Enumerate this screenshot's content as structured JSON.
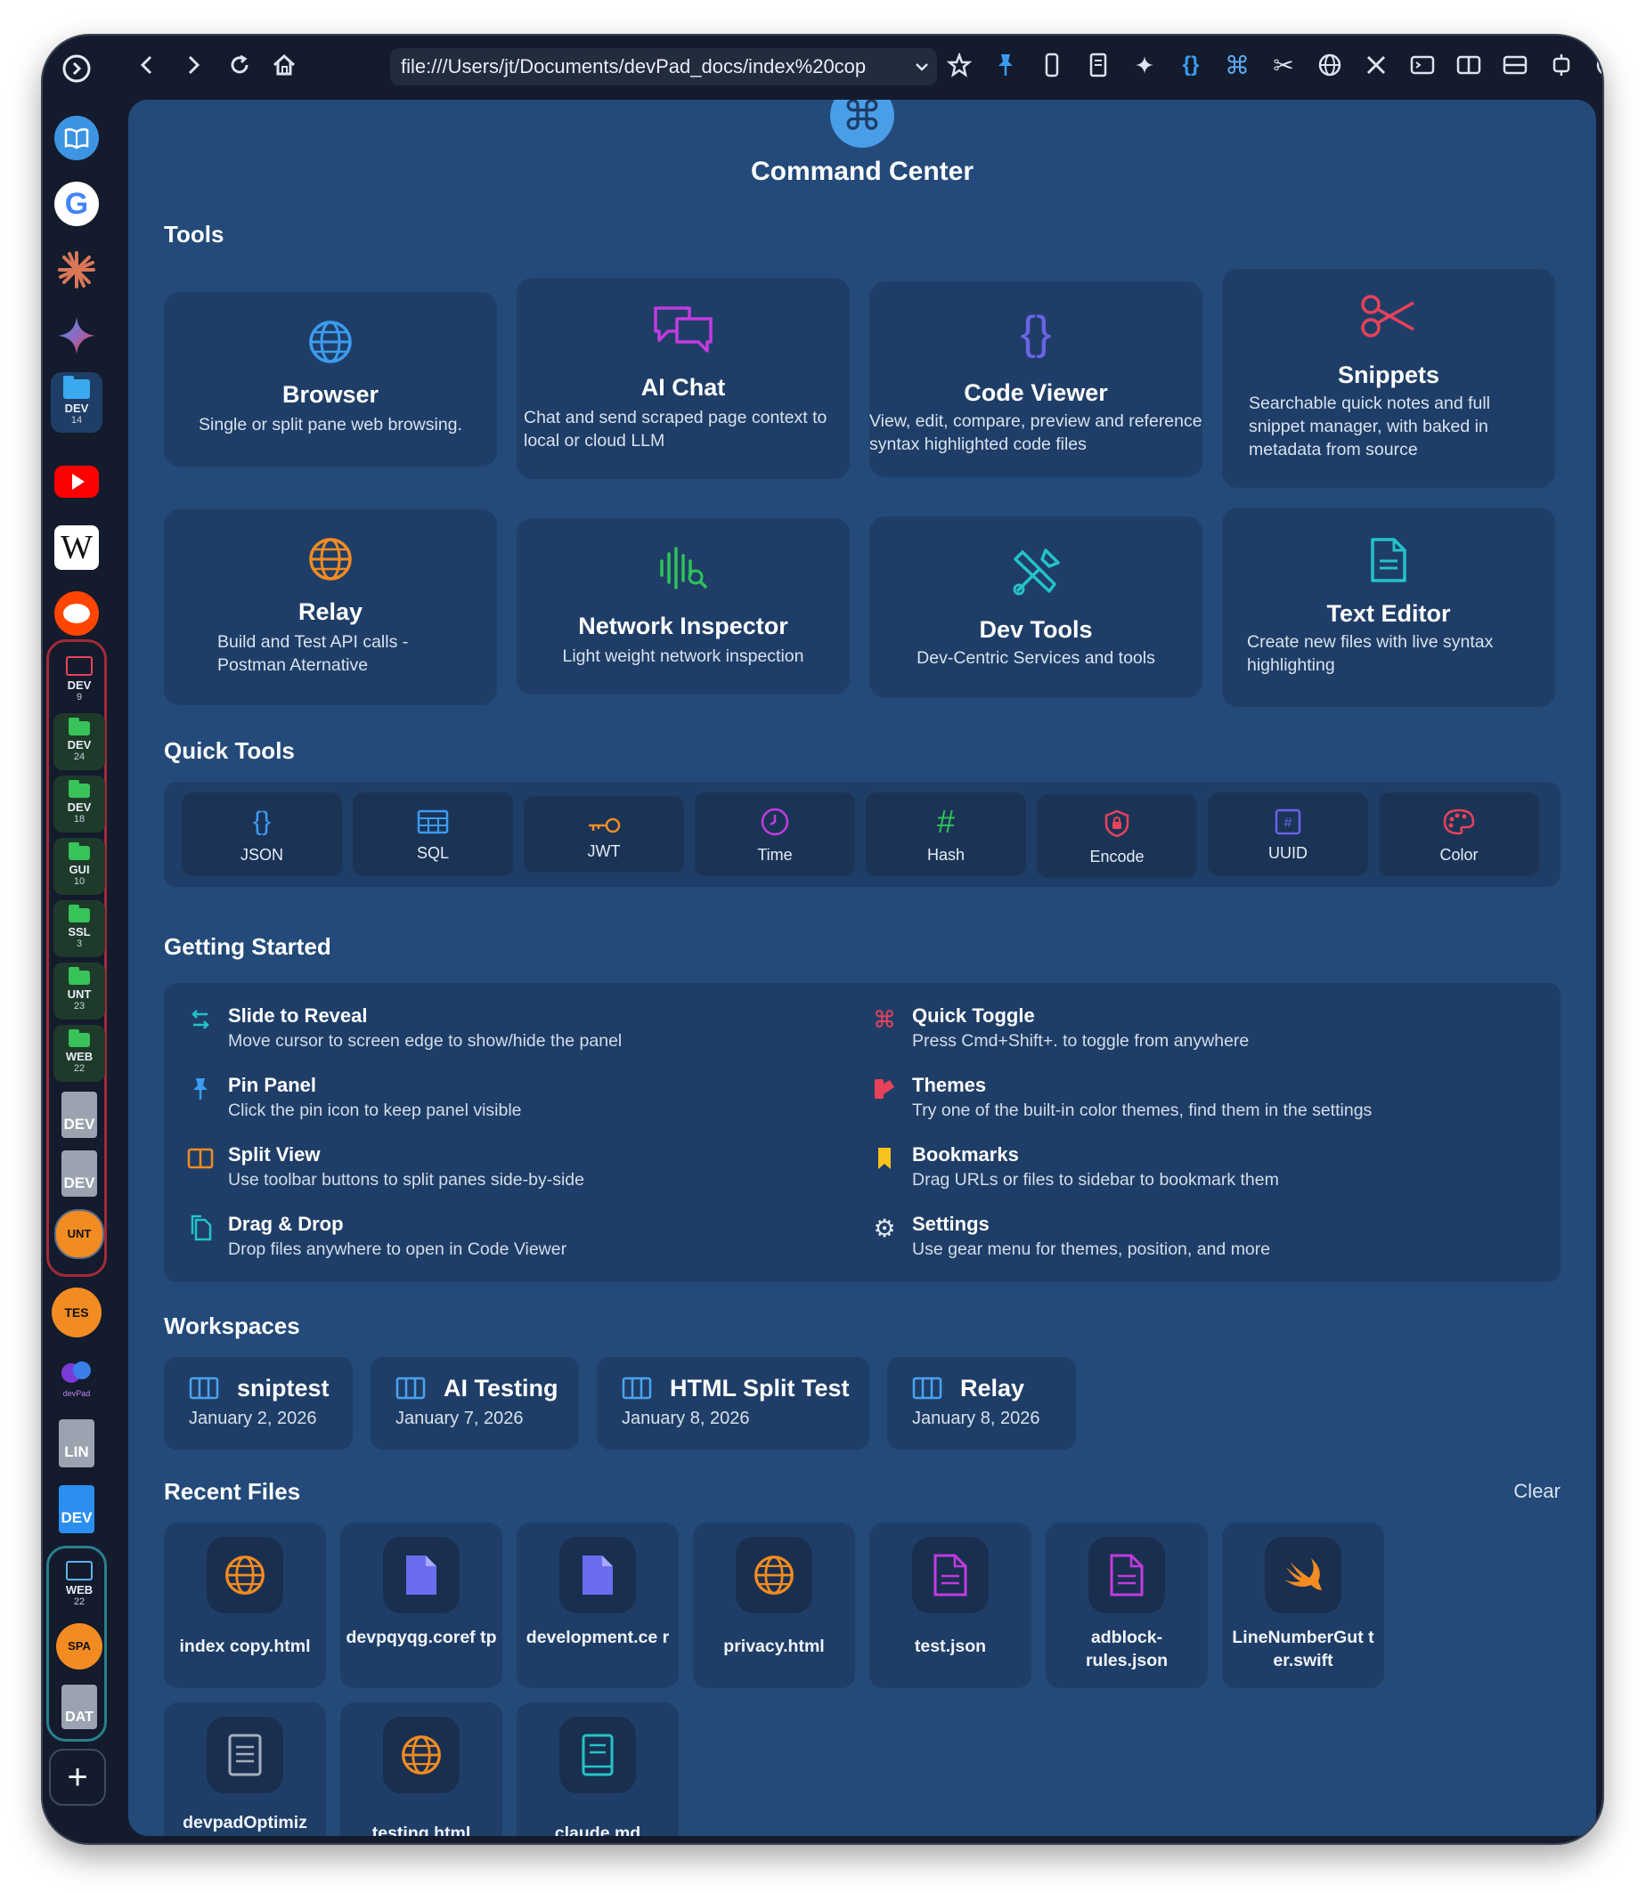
{
  "toolbar": {
    "url": "file:///Users/jt/Documents/devPad_docs/index%20cop",
    "icons": [
      "back-icon",
      "forward-icon",
      "reload-icon",
      "home-icon",
      "star-icon",
      "pin-icon",
      "mobile-icon",
      "reader-icon",
      "sparkle-icon",
      "braces-icon",
      "command-icon",
      "scissors-icon",
      "globe-icon",
      "tools-icon",
      "terminal-icon",
      "split-vertical-icon",
      "split-horizontal-icon",
      "extension-icon",
      "download-icon",
      "gear-icon"
    ]
  },
  "sidebar": {
    "items": [
      {
        "label": "DEV",
        "count": "14"
      },
      {
        "label": "DEV",
        "count": "9"
      },
      {
        "label": "DEV",
        "count": "24"
      },
      {
        "label": "DEV",
        "count": "18"
      },
      {
        "label": "GUI",
        "count": "10"
      },
      {
        "label": "SSL",
        "count": "3"
      },
      {
        "label": "UNT",
        "count": "23"
      },
      {
        "label": "WEB",
        "count": "22"
      },
      {
        "label": "DEV"
      },
      {
        "label": "DEV"
      },
      {
        "label": "UNT"
      },
      {
        "label": "TES"
      },
      {
        "label": "devPad"
      },
      {
        "label": "LIN"
      },
      {
        "label": "DEV"
      },
      {
        "label": "WEB",
        "count": "22"
      },
      {
        "label": "SPA"
      },
      {
        "label": "DAT"
      }
    ],
    "add_label": "+"
  },
  "header": {
    "title": "Command Center"
  },
  "sections": {
    "tools": "Tools",
    "quick_tools": "Quick Tools",
    "getting_started": "Getting Started",
    "workspaces": "Workspaces",
    "recent_files": "Recent Files",
    "clear": "Clear"
  },
  "tools": [
    {
      "title": "Browser",
      "desc": "Single or split pane web browsing."
    },
    {
      "title": "AI Chat",
      "desc": "Chat and send scraped page context to local or cloud LLM"
    },
    {
      "title": "Code Viewer",
      "desc": "View, edit, compare, preview and reference syntax highlighted code files"
    },
    {
      "title": "Snippets",
      "desc": "Searchable quick notes and full snippet manager, with baked in metadata from source"
    },
    {
      "title": "Relay",
      "desc": "Build and Test API calls - Postman Aternative"
    },
    {
      "title": "Network Inspector",
      "desc": "Light weight network inspection"
    },
    {
      "title": "Dev Tools",
      "desc": "Dev-Centric Services and tools"
    },
    {
      "title": "Text Editor",
      "desc": "Create new files with live syntax highlighting"
    }
  ],
  "quick_tools": [
    "JSON",
    "SQL",
    "JWT",
    "Time",
    "Hash",
    "Encode",
    "UUID",
    "Color"
  ],
  "getting_started": [
    {
      "title": "Slide to Reveal",
      "desc": "Move cursor to screen edge to show/hide the panel"
    },
    {
      "title": "Pin Panel",
      "desc": "Click the pin icon to keep panel visible"
    },
    {
      "title": "Split View",
      "desc": "Use toolbar buttons to split panes side-by-side"
    },
    {
      "title": "Drag & Drop",
      "desc": "Drop files anywhere to open in Code Viewer"
    },
    {
      "title": "Quick Toggle",
      "desc": "Press Cmd+Shift+. to toggle from anywhere"
    },
    {
      "title": "Themes",
      "desc": "Try one of the built-in color themes, find them in the settings"
    },
    {
      "title": "Bookmarks",
      "desc": "Drag URLs or files to sidebar to bookmark them"
    },
    {
      "title": "Settings",
      "desc": "Use gear menu for themes, position, and more"
    }
  ],
  "workspaces": [
    {
      "name": "sniptest",
      "date": "January 2, 2026"
    },
    {
      "name": "AI Testing",
      "date": "January 7, 2026"
    },
    {
      "name": "HTML Split Test",
      "date": "January 8, 2026"
    },
    {
      "name": "Relay",
      "date": "January 8, 2026"
    }
  ],
  "recent_files": [
    {
      "name": "index copy.html",
      "icon": "globe-icon"
    },
    {
      "name": "devpqyqg.coref tp",
      "icon": "file-icon"
    },
    {
      "name": "development.ce r",
      "icon": "file-icon"
    },
    {
      "name": "privacy.html",
      "icon": "globe-icon"
    },
    {
      "name": "test.json",
      "icon": "json-file-icon"
    },
    {
      "name": "adblock-rules.json",
      "icon": "json-file-icon"
    },
    {
      "name": "LineNumberGut ter.swift",
      "icon": "swift-icon"
    },
    {
      "name": "devpadOptimiz",
      "icon": "document-icon"
    },
    {
      "name": "testing.html",
      "icon": "globe-icon"
    },
    {
      "name": "claude.md",
      "icon": "book-icon"
    }
  ],
  "colors": {
    "panel": "#234a79",
    "card": "#1f3e67",
    "accent_blue": "#3b9cf0",
    "accent_purple": "#c23be0",
    "accent_red": "#e8425a",
    "accent_orange": "#f28c22",
    "accent_green": "#2fc25a",
    "accent_teal": "#24c3c8"
  }
}
